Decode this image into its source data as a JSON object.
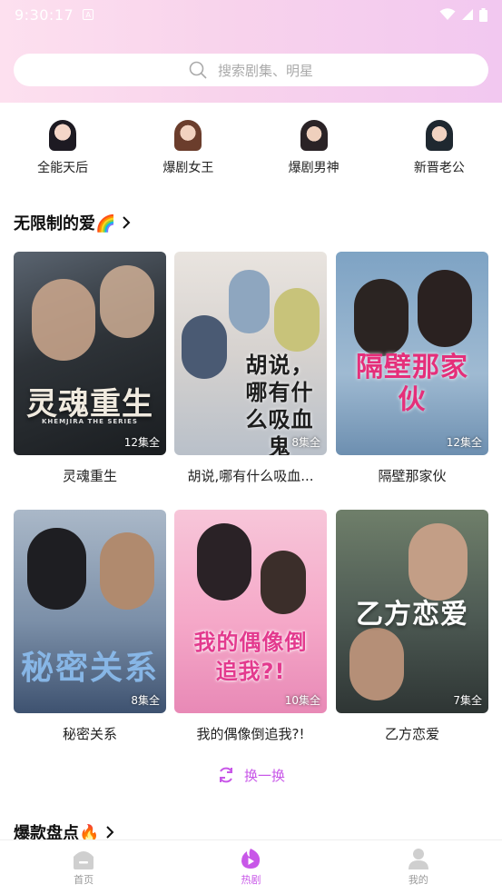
{
  "status_bar": {
    "time": "9:30:17",
    "sim_label": "A"
  },
  "search": {
    "placeholder": "搜索剧集、明星"
  },
  "categories": [
    {
      "label": "全能天后"
    },
    {
      "label": "爆剧女王"
    },
    {
      "label": "爆剧男神"
    },
    {
      "label": "新晋老公"
    }
  ],
  "section1": {
    "title": "无限制的爱🌈"
  },
  "dramas": [
    {
      "name": "灵魂重生",
      "poster_title": "灵魂重生",
      "poster_sub": "KHEMJIRA THE SERIES",
      "episodes": "12集全"
    },
    {
      "name": "胡说,哪有什么吸血...",
      "poster_title": "胡说，哪有什么吸血鬼",
      "episodes": "8集全"
    },
    {
      "name": "隔壁那家伙",
      "poster_title": "隔壁那家伙",
      "episodes": "12集全"
    },
    {
      "name": "秘密关系",
      "poster_title": "秘密关系",
      "episodes": "8集全"
    },
    {
      "name": "我的偶像倒追我?!",
      "poster_title": "我的偶像倒追我?!",
      "episodes": "10集全"
    },
    {
      "name": "乙方恋爱",
      "poster_title": "乙方恋爱",
      "episodes": "7集全"
    }
  ],
  "refresh": {
    "label": "换一换"
  },
  "section2": {
    "title": "爆款盘点🔥"
  },
  "bottom_nav": [
    {
      "label": "首页",
      "active": false
    },
    {
      "label": "热剧",
      "active": true
    },
    {
      "label": "我的",
      "active": false
    }
  ],
  "colors": {
    "accent": "#c857e8",
    "header_start": "#fde0ef",
    "header_end": "#f2c8f0"
  }
}
